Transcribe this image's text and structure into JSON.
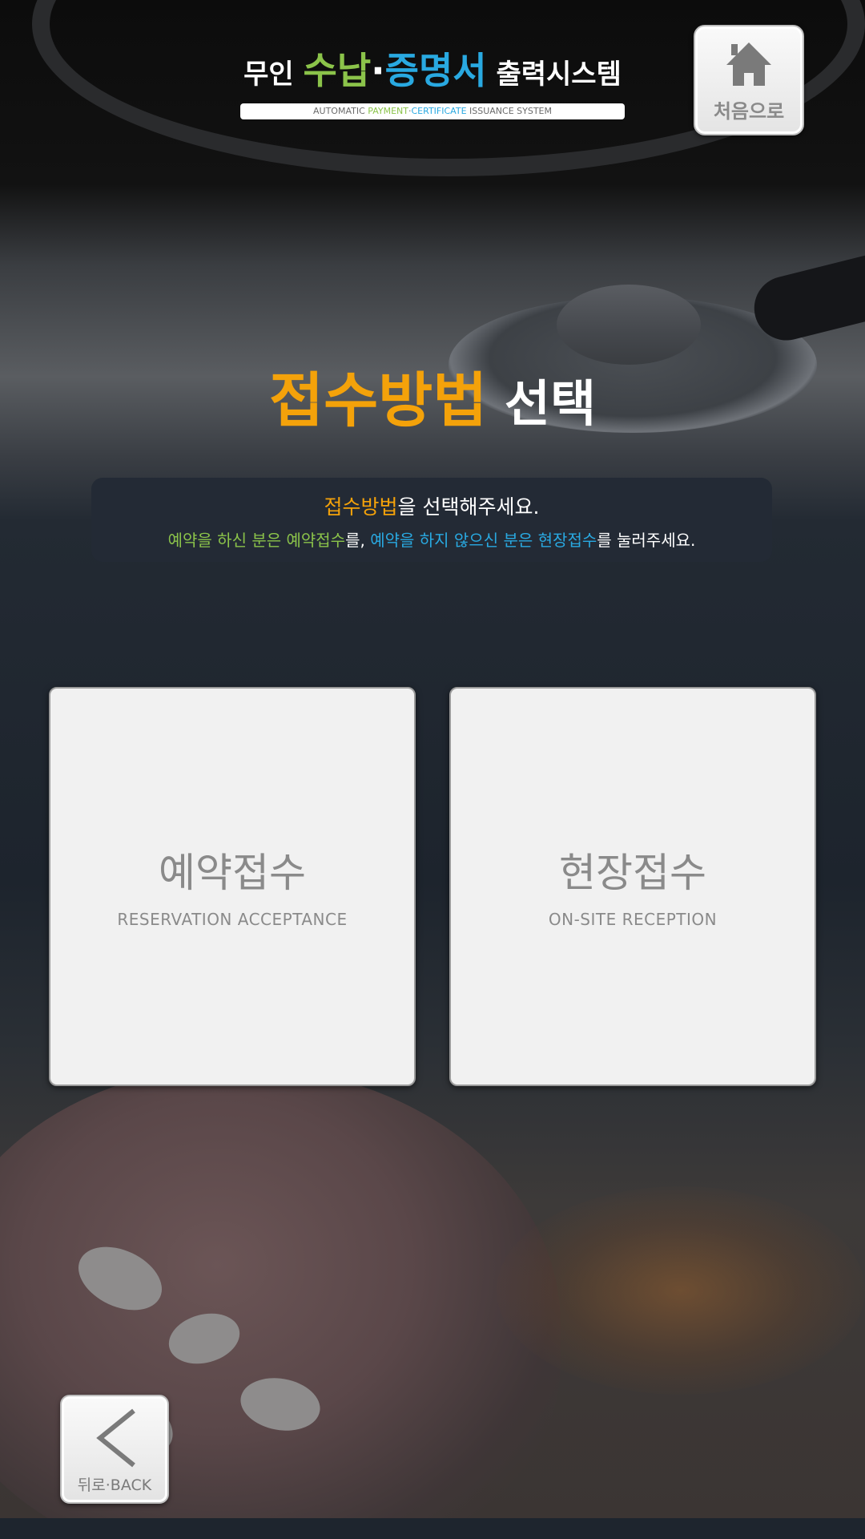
{
  "header": {
    "title_prefix": "무인 ",
    "title_green": "수납",
    "title_dot": "·",
    "title_blue": "증명서",
    "title_suffix": " 출력시스템",
    "subtitle_prefix": "AUTOMATIC ",
    "subtitle_green": "PAYMENT",
    "subtitle_dot": "·",
    "subtitle_blue": "CERTIFICATE",
    "subtitle_suffix": " ISSUANCE SYSTEM"
  },
  "home_button": {
    "label": "처음으로",
    "icon": "home-icon"
  },
  "heading": {
    "highlight": "접수방법",
    "rest": " 선택"
  },
  "info": {
    "line1_highlight": "접수방법",
    "line1_rest": "을 선택해주세요.",
    "line2_green": "예약을 하신 분은 예약접수",
    "line2_mid": "를, ",
    "line2_blue": "예약을 하지 않으신 분은 현장접수",
    "line2_end": "를 눌러주세요."
  },
  "options": [
    {
      "title": "예약접수",
      "subtitle": "RESERVATION ACCEPTANCE"
    },
    {
      "title": "현장접수",
      "subtitle": "ON-SITE RECEPTION"
    }
  ],
  "back_button": {
    "label": "뒤로·BACK",
    "icon": "chevron-left-icon"
  },
  "colors": {
    "accent_orange": "#f4a20a",
    "accent_green": "#8bc34a",
    "accent_blue": "#29a9e1"
  }
}
